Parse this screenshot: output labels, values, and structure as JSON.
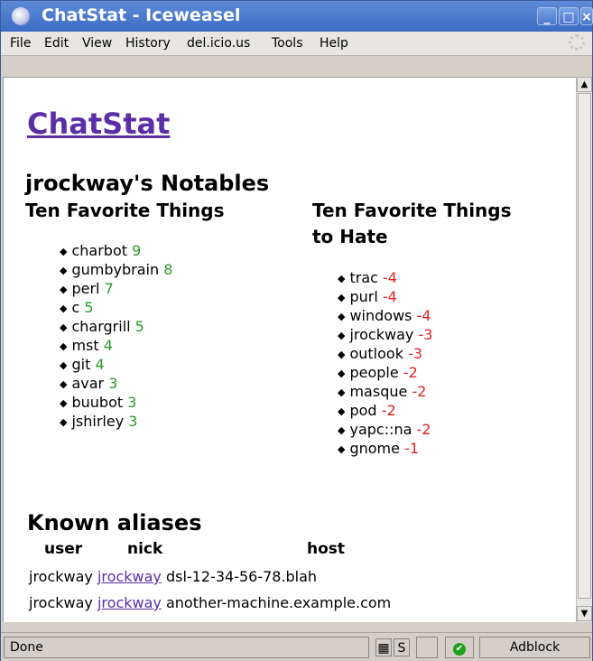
{
  "window": {
    "title": "ChatStat - Iceweasel"
  },
  "menu": [
    "File",
    "Edit",
    "View",
    "History",
    "del.icio.us",
    "Tools",
    "Help"
  ],
  "page": {
    "title": "ChatStat",
    "notables_heading": "jrockway's Notables",
    "favorites_heading": "Ten Favorite Things",
    "hate_heading_line1": "Ten Favorite Things",
    "hate_heading_line2": "to Hate",
    "favorites": [
      {
        "name": "charbot",
        "score": "9"
      },
      {
        "name": "gumbybrain",
        "score": "8"
      },
      {
        "name": "perl",
        "score": "7"
      },
      {
        "name": "c",
        "score": "5"
      },
      {
        "name": "chargrill",
        "score": "5"
      },
      {
        "name": "mst",
        "score": "4"
      },
      {
        "name": "git",
        "score": "4"
      },
      {
        "name": "avar",
        "score": "3"
      },
      {
        "name": "buubot",
        "score": "3"
      },
      {
        "name": "jshirley",
        "score": "3"
      }
    ],
    "hates": [
      {
        "name": "trac",
        "score": "-4"
      },
      {
        "name": "purl",
        "score": "-4"
      },
      {
        "name": "windows",
        "score": "-4"
      },
      {
        "name": "jrockway",
        "score": "-3"
      },
      {
        "name": "outlook",
        "score": "-3"
      },
      {
        "name": "people",
        "score": "-2"
      },
      {
        "name": "masque",
        "score": "-2"
      },
      {
        "name": "pod",
        "score": "-2"
      },
      {
        "name": "yapc::na",
        "score": "-2"
      },
      {
        "name": "gnome",
        "score": "-1"
      }
    ],
    "aliases_heading": "Known aliases",
    "alias_columns": [
      "user",
      "nick",
      "host"
    ],
    "aliases": [
      {
        "user": "jrockway",
        "nick": "jrockway",
        "host": "dsl-12-34-56-78.blah"
      },
      {
        "user": "jrockway",
        "nick": "jrockway",
        "host": "another-machine.example.com"
      }
    ]
  },
  "status": {
    "text": "Done",
    "adblock": "Adblock"
  },
  "colors": {
    "link": "#5a2ea6",
    "positive": "#2a9a2a",
    "negative": "#e02020",
    "titlebar": "#3b6cc4"
  }
}
